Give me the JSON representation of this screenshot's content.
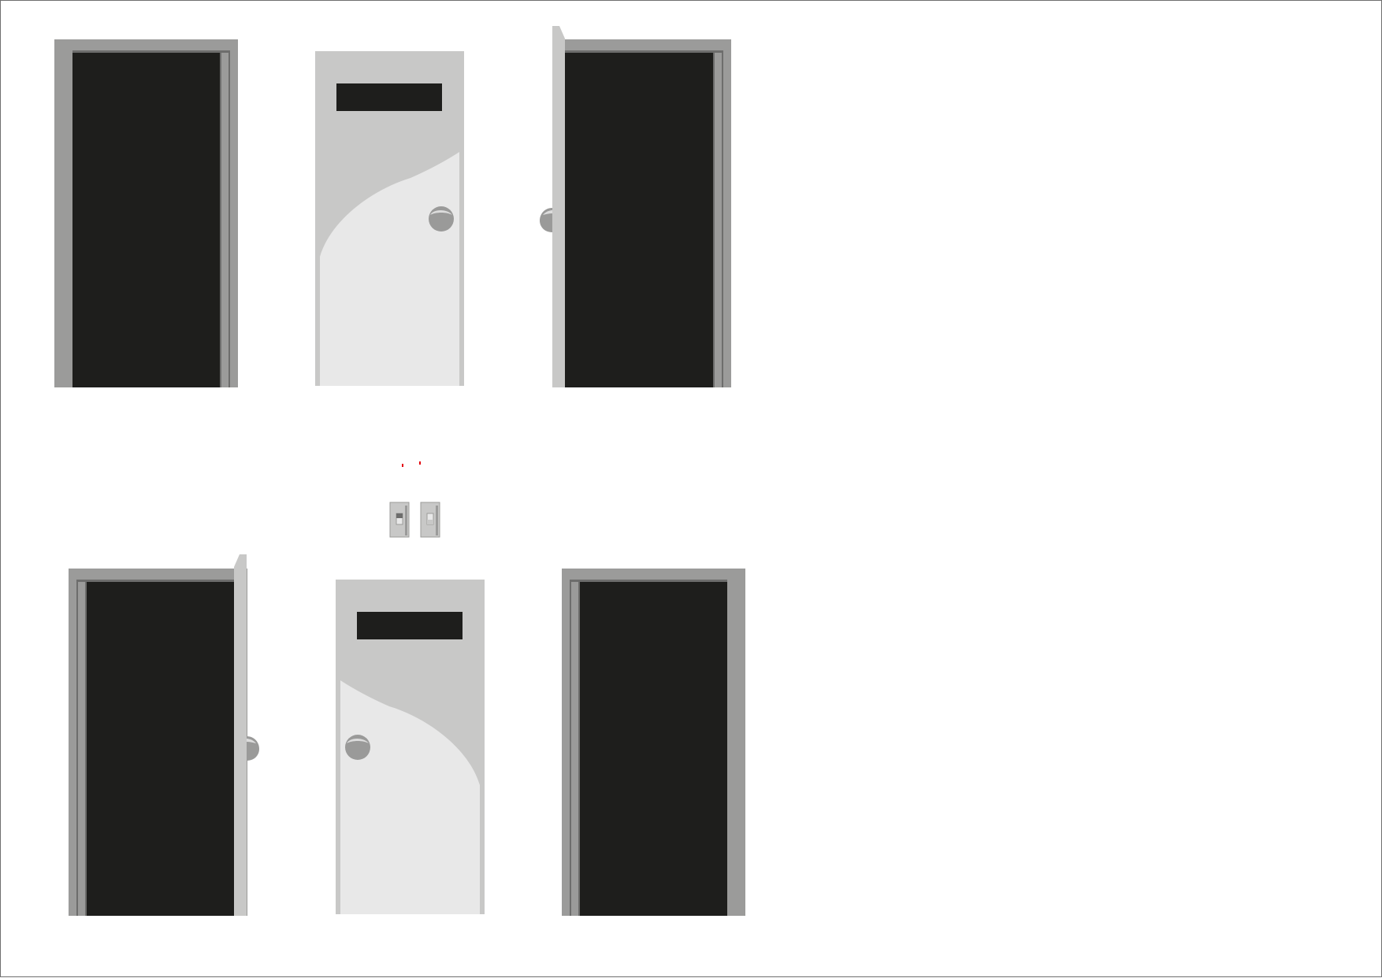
{
  "sheet": {
    "title": "",
    "background_color": "#ffffff",
    "border_color": "#6f6f6f"
  },
  "palette": {
    "frame_gray": "#9b9b9a",
    "frame_edge": "#6d6d6c",
    "opening_black": "#1e1e1c",
    "door_leaf_gray": "#c8c8c7",
    "door_panel_light": "#e8e8e8",
    "knob_gray": "#9a9a99",
    "knob_highlight": "#dcdcdc",
    "switch_indicator_red": "#e3000f"
  },
  "doors": [
    {
      "id": "door-closed-frame-top-left",
      "state": "empty frame"
    },
    {
      "id": "door-closed-leaf-top-middle",
      "state": "closed door, knob on right"
    },
    {
      "id": "door-open-top-right",
      "state": "open door, hinged on left"
    },
    {
      "id": "door-open-bottom-left",
      "state": "open door, hinged on right"
    },
    {
      "id": "door-closed-leaf-bottom-middle",
      "state": "closed door, knob on left"
    },
    {
      "id": "door-closed-frame-bottom-right",
      "state": "empty frame"
    }
  ],
  "switches": [
    {
      "id": "light-switch-left",
      "state": "off"
    },
    {
      "id": "light-switch-right",
      "state": "on"
    }
  ]
}
